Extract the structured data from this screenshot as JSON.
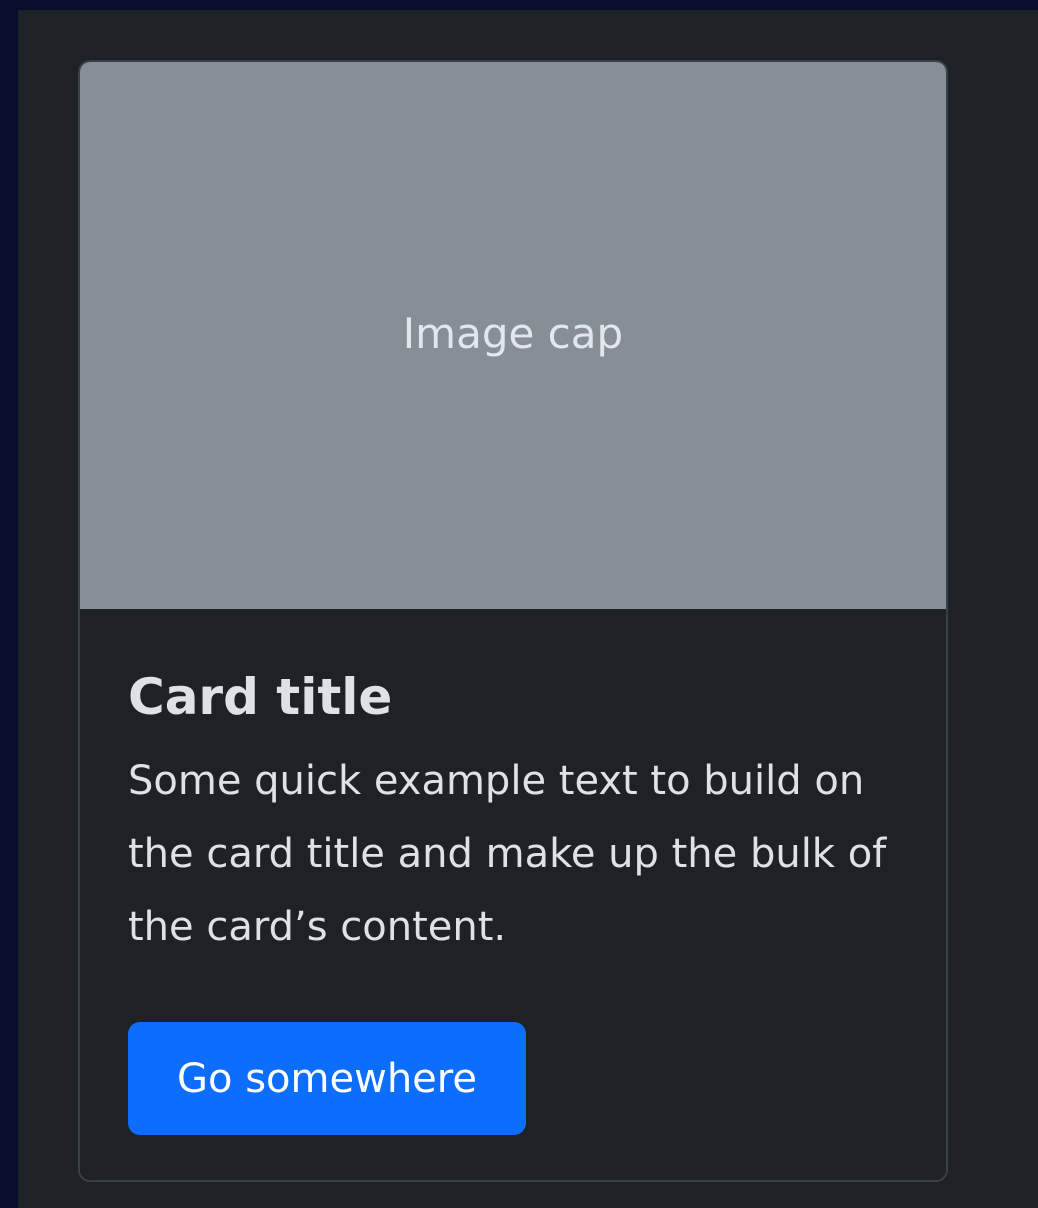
{
  "card": {
    "image_cap": "Image cap",
    "title": "Card title",
    "text": "Some quick example text to build on the card title and make up the bulk of the card’s content.",
    "button_label": "Go somewhere"
  },
  "colors": {
    "page_background": "#080d2b",
    "surface_background": "#1e2125",
    "image_placeholder": "#868e96",
    "primary_button": "#0d6efd",
    "text": "#dee2e6"
  }
}
